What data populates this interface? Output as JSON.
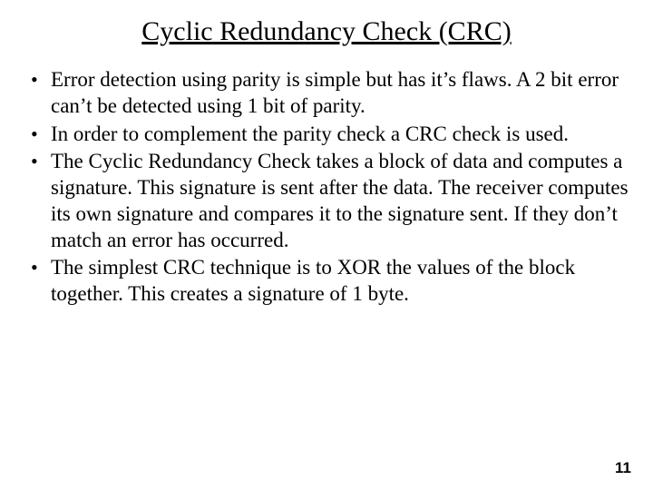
{
  "slide": {
    "title": "Cyclic Redundancy Check (CRC)",
    "bullets": [
      "Error detection using parity is simple but has it’s flaws. A 2 bit error can’t be detected using 1 bit of parity.",
      "In order to complement the parity check a CRC check is used.",
      "The Cyclic Redundancy Check takes a block of data and computes a signature. This signature is sent after the data. The receiver computes its own signature and compares it to the signature sent. If they don’t match an error has occurred.",
      "The simplest CRC technique is to XOR the values of the block together. This creates a signature of 1 byte."
    ],
    "page_number": "11"
  }
}
